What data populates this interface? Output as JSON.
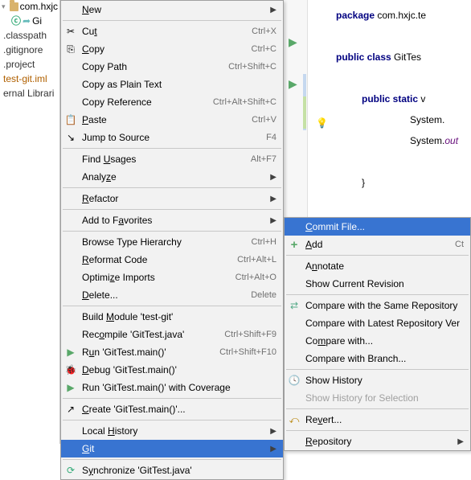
{
  "project": {
    "root": "com.hxjc",
    "sub": "Gi",
    "files": [
      ".classpath",
      ".gitignore",
      ".project",
      "test-git.iml",
      "ernal Librari"
    ]
  },
  "code": {
    "l1a": "package ",
    "l1b": "com.hxjc.te",
    "l2a": "public class ",
    "l2b": "GitTes",
    "l3a": "public static ",
    "l3b": "v",
    "l4": "System.",
    "l5a": "System.",
    "l5b": "out",
    "l6": "}",
    "l7": "}"
  },
  "menu": {
    "new": "New",
    "cut": "Cut",
    "cut_sc": "Ctrl+X",
    "copy": "Copy",
    "copy_sc": "Ctrl+C",
    "copy_path": "Copy Path",
    "copy_path_sc": "Ctrl+Shift+C",
    "copy_plain": "Copy as Plain Text",
    "copy_ref": "Copy Reference",
    "copy_ref_sc": "Ctrl+Alt+Shift+C",
    "paste": "Paste",
    "paste_sc": "Ctrl+V",
    "jump": "Jump to Source",
    "jump_sc": "F4",
    "find_usages": "Find Usages",
    "find_usages_sc": "Alt+F7",
    "analyze": "Analyze",
    "refactor": "Refactor",
    "fav": "Add to Favorites",
    "browse": "Browse Type Hierarchy",
    "browse_sc": "Ctrl+H",
    "reformat": "Reformat Code",
    "reformat_sc": "Ctrl+Alt+L",
    "optimize": "Optimize Imports",
    "optimize_sc": "Ctrl+Alt+O",
    "delete": "Delete...",
    "delete_sc": "Delete",
    "build": "Build Module 'test-git'",
    "recompile": "Recompile 'GitTest.java'",
    "recompile_sc": "Ctrl+Shift+F9",
    "run": "Run 'GitTest.main()'",
    "run_sc": "Ctrl+Shift+F10",
    "debug": "Debug 'GitTest.main()'",
    "coverage": "Run 'GitTest.main()' with Coverage",
    "create": "Create 'GitTest.main()'...",
    "local_history": "Local History",
    "git": "Git",
    "sync": "Synchronize 'GitTest.java'"
  },
  "submenu": {
    "commit": "Commit File...",
    "add": "Add",
    "add_sc": "Ct",
    "annotate": "Annotate",
    "show_rev": "Show Current Revision",
    "compare_same": "Compare with the Same Repository",
    "compare_latest": "Compare with Latest Repository Ver",
    "compare_with": "Compare with...",
    "compare_branch": "Compare with Branch...",
    "show_history": "Show History",
    "show_history_sel": "Show History for Selection",
    "revert": "Revert...",
    "repository": "Repository"
  }
}
